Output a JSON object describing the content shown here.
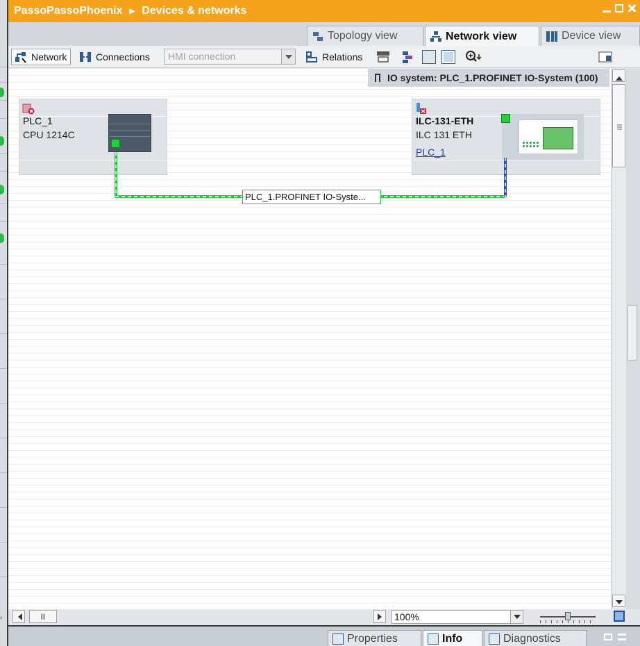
{
  "breadcrumb": {
    "project": "PassoPassoPhoenix",
    "section": "Devices & networks"
  },
  "view_tabs": [
    {
      "label": "Topology view",
      "icon": "topology-icon",
      "active": false
    },
    {
      "label": "Network view",
      "icon": "network-icon",
      "active": true
    },
    {
      "label": "Device view",
      "icon": "device-icon",
      "active": false
    }
  ],
  "toolbar": {
    "network_label": "Network",
    "connections_label": "Connections",
    "connection_type_value": "HMI connection",
    "relations_label": "Relations"
  },
  "io_system_banner": "IO system: PLC_1.PROFINET IO-System (100)",
  "devices": {
    "plc": {
      "name": "PLC_1",
      "type": "CPU 1214C"
    },
    "ilc": {
      "name": "ILC-131-ETH",
      "type": "ILC 131 ETH",
      "assigned_controller": "PLC_1"
    }
  },
  "network": {
    "label": "PLC_1.PROFINET IO-Syste..."
  },
  "zoom": {
    "value": "100%"
  },
  "inspector_tabs": [
    {
      "label": "Properties",
      "active": false
    },
    {
      "label": "Info",
      "active": true
    },
    {
      "label": "Diagnostics",
      "active": false
    }
  ],
  "colors": {
    "title_bar": "#f5a21c",
    "profinet_line": "#22c93a",
    "io_link": "#2a4fb5",
    "status_ok": "#2fb84a"
  }
}
